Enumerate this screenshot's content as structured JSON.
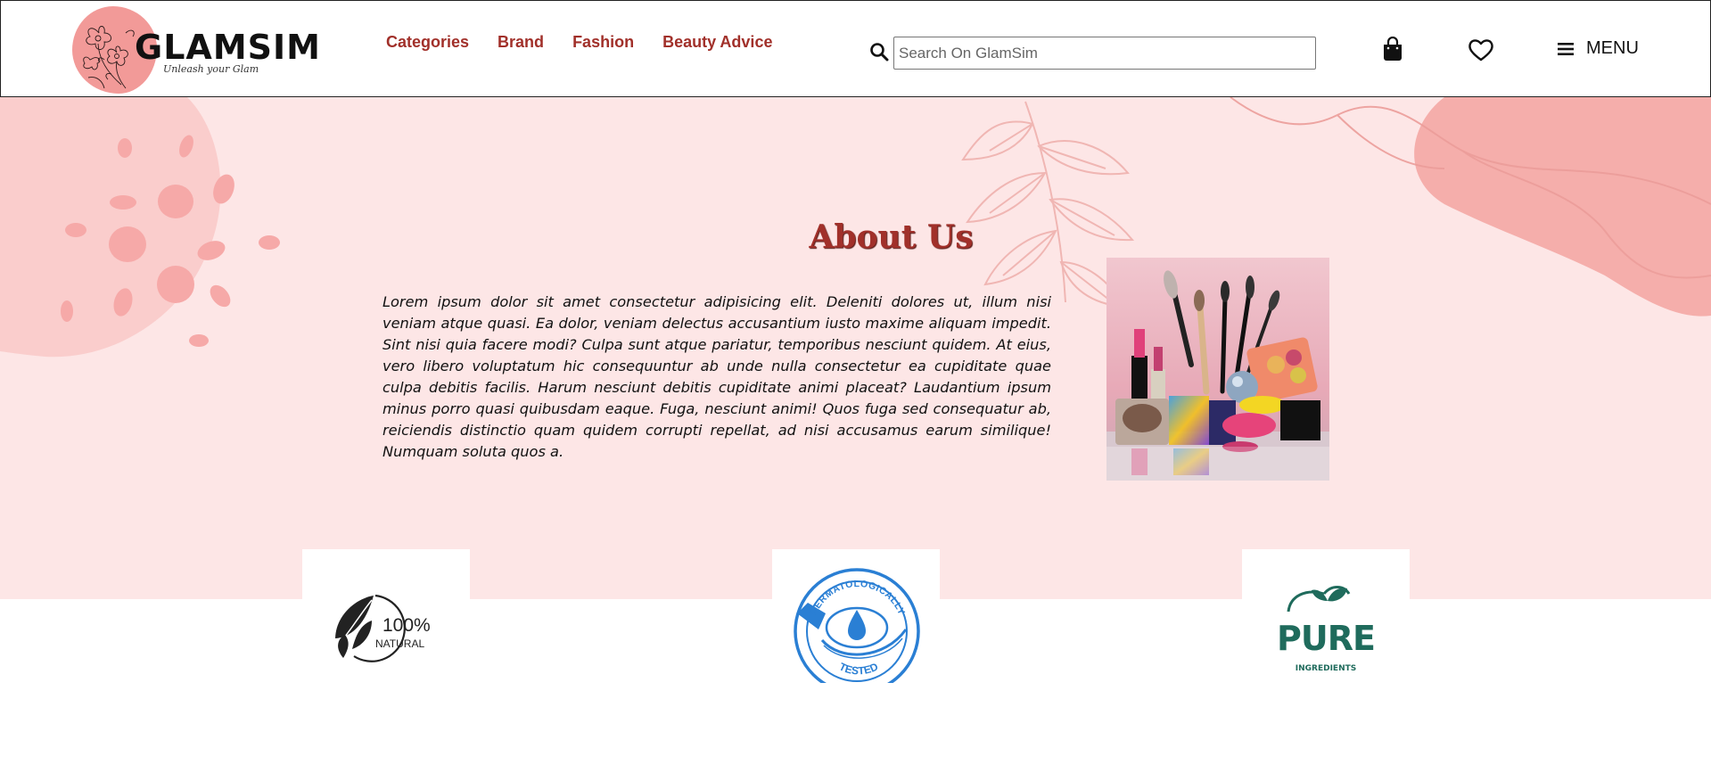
{
  "brand": {
    "name": "GLAMSIM",
    "tagline": "Unleash your Glam"
  },
  "nav": {
    "items": [
      {
        "label": "Categories"
      },
      {
        "label": "Brand"
      },
      {
        "label": "Fashion"
      },
      {
        "label": "Beauty Advice"
      }
    ]
  },
  "search": {
    "placeholder": "Search On GlamSim",
    "value": ""
  },
  "header_icons": {
    "bag": "shopping-bag-icon",
    "wishlist": "heart-icon",
    "menu": "hamburger-icon"
  },
  "menu": {
    "label": "MENU"
  },
  "about": {
    "title": "About Us",
    "body": "Lorem ipsum dolor sit amet consectetur adipisicing elit. Deleniti dolores ut, illum nisi veniam atque quasi. Ea dolor, veniam delectus accusantium iusto maxime aliquam impedit. Sint nisi quia facere modi? Culpa sunt atque pariatur, temporibus nesciunt quidem. At eius, vero libero voluptatum hic consequuntur ab unde nulla consectetur ea cupiditate quae culpa debitis facilis. Harum nesciunt debitis cupiditate animi placeat? Laudantium ipsum minus porro quasi quibusdam eaque. Fuga, nesciunt animi! Quos fuga sed consequatur ab, reiciendis distinctio quam quidem corrupti repellat, ad nisi accusamus earum similique! Numquam soluta quos a."
  },
  "badges": [
    {
      "line1": "100%",
      "line2": "NATURAL",
      "icon": "leaf-icon"
    },
    {
      "arc_top": "DERMATOLOGICALLY",
      "arc_bottom": "TESTED",
      "icon": "water-drop-icon"
    },
    {
      "line1": "PURE",
      "line2": "INGREDIENTS",
      "icon": "sprout-icon"
    }
  ],
  "colors": {
    "accent": "#a1302a",
    "hero_bg": "#fde6e6",
    "blob": "#f29a98",
    "derm_blue": "#2a7fd4",
    "pure_green": "#1f6b5c"
  }
}
